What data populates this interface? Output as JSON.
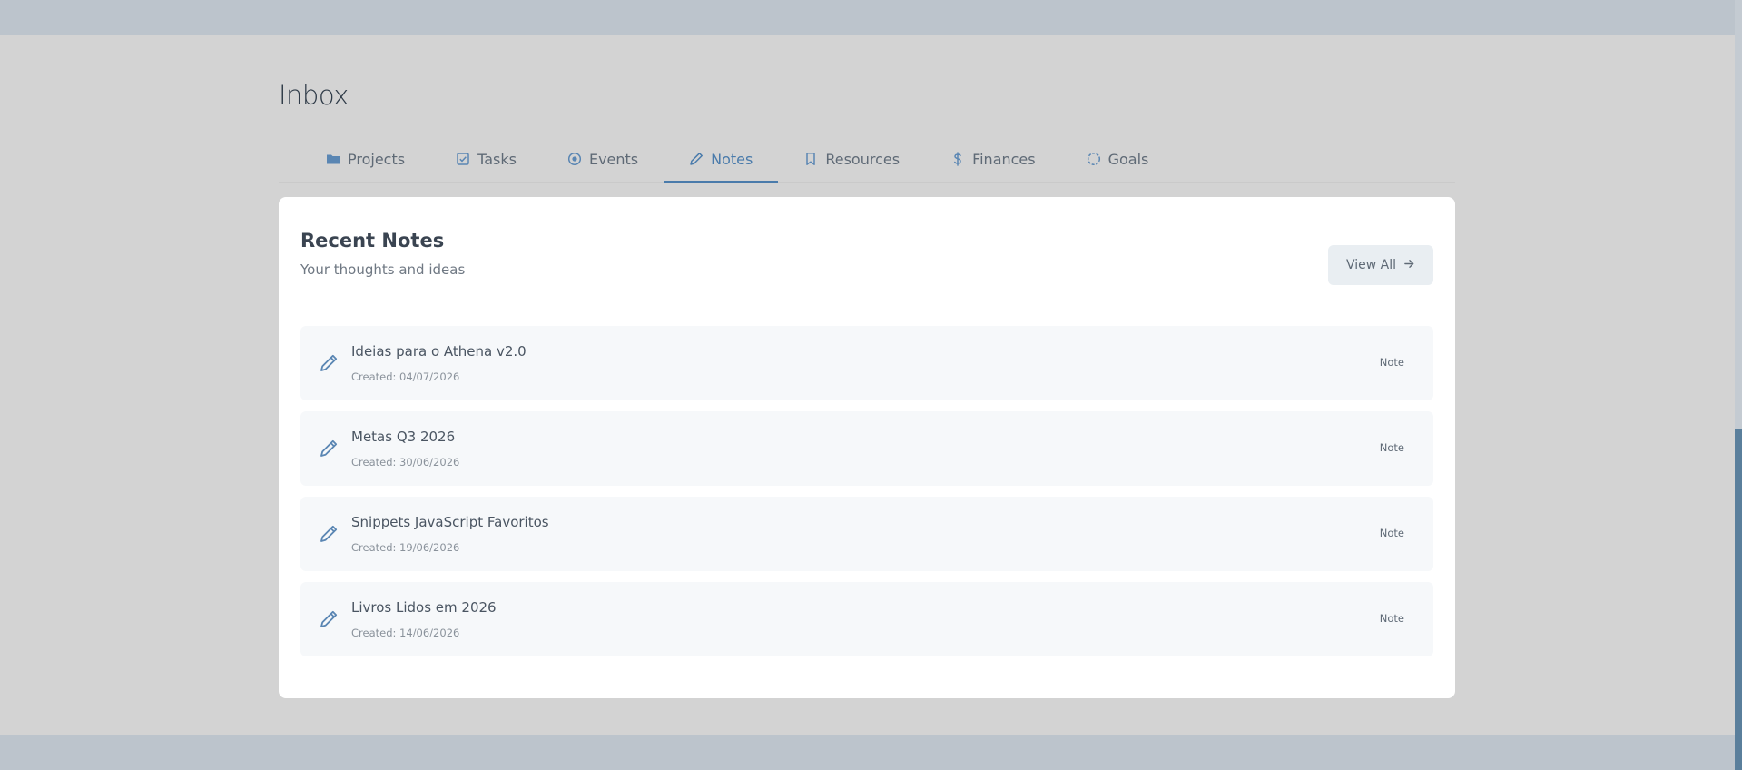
{
  "page": {
    "title": "Inbox"
  },
  "tabs": [
    {
      "label": "Projects",
      "icon": "folder-icon",
      "active": false
    },
    {
      "label": "Tasks",
      "icon": "checkbox-icon",
      "active": false
    },
    {
      "label": "Events",
      "icon": "clock-icon",
      "active": false
    },
    {
      "label": "Notes",
      "icon": "pencil-icon",
      "active": true
    },
    {
      "label": "Resources",
      "icon": "bookmark-icon",
      "active": false
    },
    {
      "label": "Finances",
      "icon": "dollar-icon",
      "active": false
    },
    {
      "label": "Goals",
      "icon": "target-icon",
      "active": false
    }
  ],
  "card": {
    "title": "Recent Notes",
    "subtitle": "Your thoughts and ideas",
    "view_all_label": "View All"
  },
  "notes": [
    {
      "title": "Ideias para o Athena v2.0",
      "date": "Created: 04/07/2026",
      "badge": "Note"
    },
    {
      "title": "Metas Q3 2026",
      "date": "Created: 30/06/2026",
      "badge": "Note"
    },
    {
      "title": "Snippets JavaScript Favoritos",
      "date": "Created: 19/06/2026",
      "badge": "Note"
    },
    {
      "title": "Livros Lidos em 2026",
      "date": "Created: 14/06/2026",
      "badge": "Note"
    }
  ],
  "colors": {
    "accent": "#4a7bab",
    "overlay": "#d3d3d3",
    "page_background": "#bcc4cc",
    "card_background": "#ffffff",
    "scrollbar_thumb": "#5a7f9c"
  }
}
